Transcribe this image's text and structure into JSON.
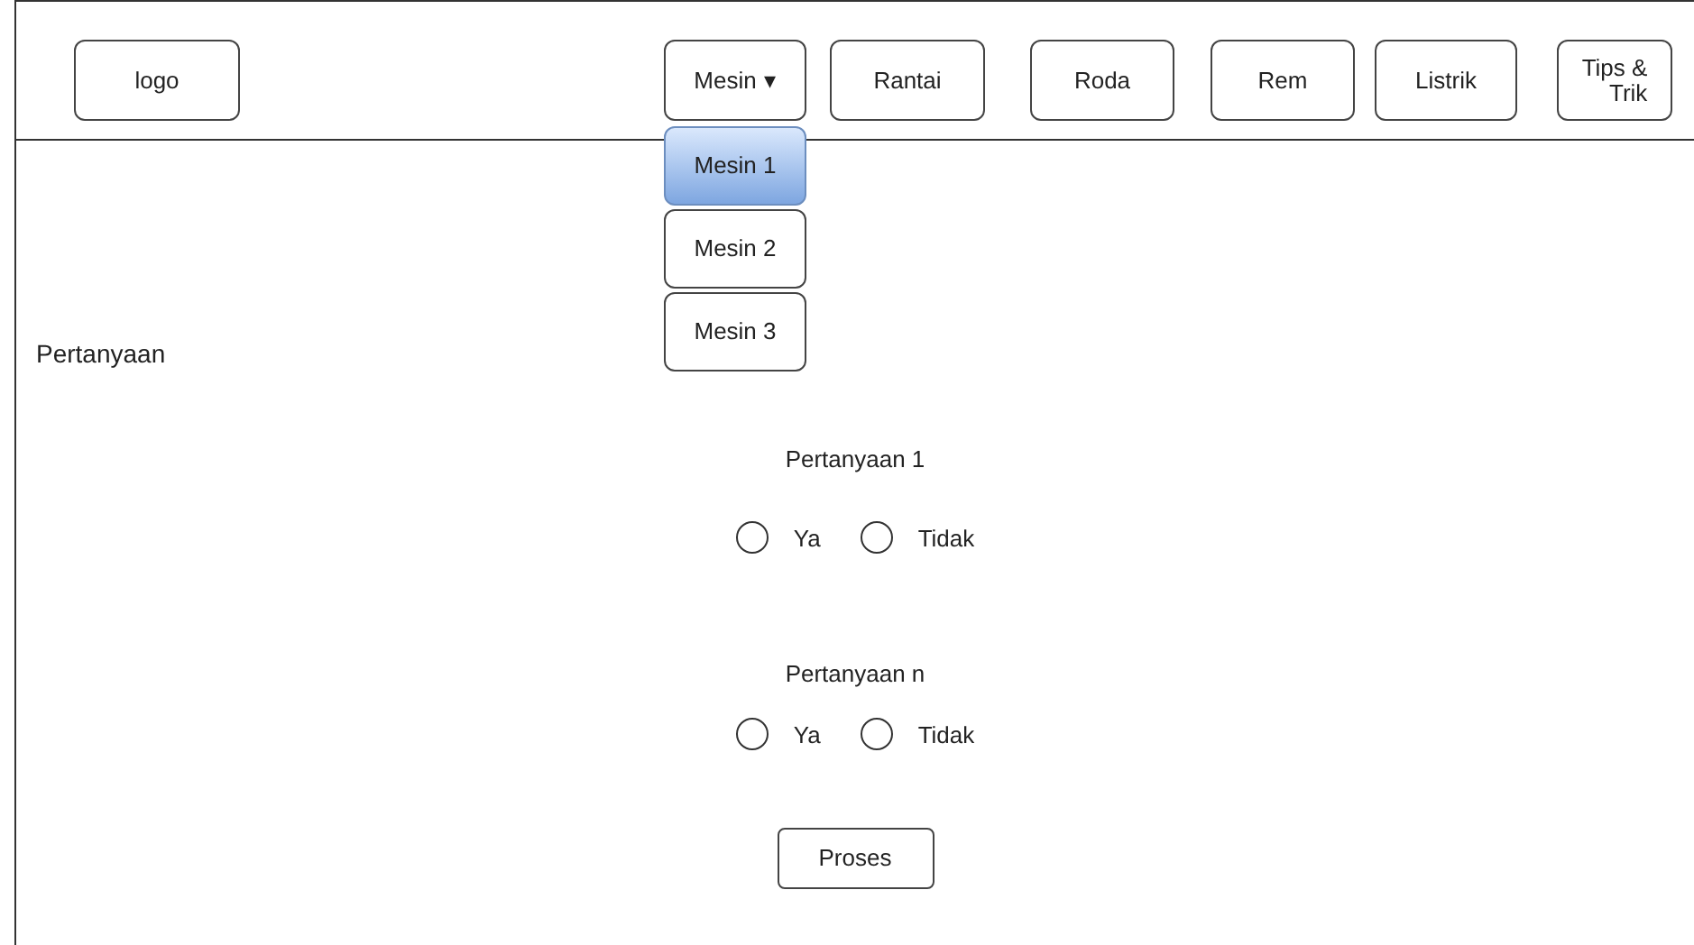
{
  "header": {
    "logo": "logo",
    "nav": [
      {
        "label": "Mesin",
        "caret": "▾",
        "kind": "dropdown"
      },
      {
        "label": "Rantai",
        "kind": "button"
      },
      {
        "label": "Roda",
        "kind": "button"
      },
      {
        "label": "Rem",
        "kind": "button"
      },
      {
        "label": "Listrik",
        "kind": "button"
      },
      {
        "label": "Tips &\nTrik",
        "kind": "button"
      }
    ]
  },
  "dropdown": {
    "items": [
      {
        "label": "Mesin 1",
        "selected": true
      },
      {
        "label": "Mesin 2",
        "selected": false
      },
      {
        "label": "Mesin 3",
        "selected": false
      }
    ]
  },
  "section_title": "Pertanyaan",
  "questions": [
    {
      "text": "Pertanyaan 1",
      "options": [
        {
          "label": "Ya",
          "selected": false
        },
        {
          "label": "Tidak",
          "selected": false
        }
      ]
    },
    {
      "text": "Pertanyaan n",
      "options": [
        {
          "label": "Ya",
          "selected": false
        },
        {
          "label": "Tidak",
          "selected": false
        }
      ]
    }
  ],
  "submit": "Proses"
}
